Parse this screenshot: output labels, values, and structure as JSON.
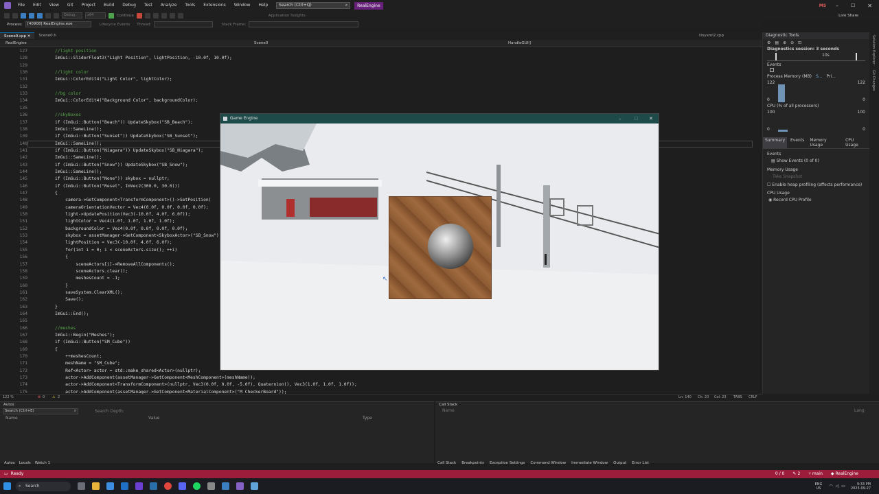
{
  "app": {
    "menu": [
      "File",
      "Edit",
      "View",
      "Git",
      "Project",
      "Build",
      "Debug",
      "Test",
      "Analyze",
      "Tools",
      "Extensions",
      "Window",
      "Help"
    ],
    "search_placeholder": "Search (Ctrl+Q)",
    "solution_name": "RealEngine",
    "user_initials": "MS",
    "live_share": "Live Share",
    "app_insights": "Application Insights",
    "continue_label": "Continue",
    "toolbar_config": "Debug",
    "toolbar_platform": "x64"
  },
  "process": {
    "label": "Process:",
    "value": "[40908] RealEngine.exe",
    "lifecycle": "Lifecycle Events",
    "thread": "Thread:",
    "stack_frame": "Stack Frame:"
  },
  "tabs": [
    {
      "label": "Scene0.cpp"
    },
    {
      "label": "Scene0.h"
    },
    {
      "label": "tinyxml2.cpp"
    }
  ],
  "navbar": {
    "project": "RealEngine",
    "scope": "Scene0",
    "member": "HandleGUI()"
  },
  "editor": {
    "line_numbers": [
      "127",
      "128",
      "129",
      "130",
      "131",
      "132",
      "133",
      "134",
      "135",
      "136",
      "137",
      "138",
      "139",
      "140",
      "141",
      "142",
      "143",
      "144",
      "145",
      "146",
      "147",
      "148",
      "149",
      "150",
      "151",
      "152",
      "153",
      "154",
      "155",
      "156",
      "157",
      "158",
      "159",
      "160",
      "161",
      "162",
      "163",
      "164",
      "165",
      "166",
      "167",
      "168",
      "169",
      "170",
      "171",
      "172",
      "173",
      "174",
      "175"
    ],
    "lines": [
      "//light position",
      "ImGui::SliderFloat3(\"Light Position\", lightPosition, -10.0f, 10.0f);",
      "",
      "//light color",
      "ImGui::ColorEdit4(\"Light Color\", lightColor);",
      "",
      "//bg color",
      "ImGui::ColorEdit4(\"Background Color\", backgroundColor);",
      "",
      "//skyBoxes",
      "if (ImGui::Button(\"Beach\")) UpdateSkybox(\"SB_Beach\");",
      "ImGui::SameLine();",
      "if (ImGui::Button(\"Sunset\")) UpdateSkybox(\"SB_Sunset\");",
      "ImGui::SameLine();",
      "if (ImGui::Button(\"Niagara\")) UpdateSkybox(\"SB_Niagara\");",
      "ImGui::SameLine();",
      "if (ImGui::Button(\"Snow\")) UpdateSkybox(\"SB_Snow\");",
      "ImGui::SameLine();",
      "if (ImGui::Button(\"None\")) skybox = nullptr;",
      "if (ImGui::Button(\"Reset\", ImVec2(300.0, 30.0)))",
      "{",
      "    camera->GetComponent<TransformComponent>()->SetPosition(",
      "    cameraOrientationVector = Vec4(0.0f, 0.0f, 0.0f, 0.0f);",
      "    light->UpdatePosition(Vec3(-10.0f, 4.0f, 6.0f));",
      "    lightColor = Vec4(1.0f, 1.0f, 1.0f, 1.0f);",
      "    backgroundColor = Vec4(0.0f, 0.0f, 0.0f, 0.0f);",
      "    skybox = assetManager->GetComponent<SkyboxActor>(\"SB_Snow\");",
      "    lightPosition = Vec3(-10.0f, 4.0f, 6.0f);",
      "    for(int i = 0; i < sceneActors.size(); ++i)",
      "    {",
      "        sceneActors[i]->RemoveAllComponents();",
      "        sceneActors.clear();",
      "        meshesCount = -1;",
      "    }",
      "    saveSystem.ClearXML();",
      "    Save();",
      "}",
      "ImGui::End();",
      "",
      "//meshes",
      "ImGui::Begin(\"Meshes\");",
      "if (ImGui::Button(\"SM_Cube\"))",
      "{",
      "    ++meshesCount;",
      "    meshName = \"SM_Cube\";",
      "    Ref<Actor> actor = std::make_shared<Actor>(nullptr);",
      "    actor->AddComponent(assetManager->GetComponent<MeshComponent>(meshName));",
      "    actor->AddComponent<TransformComponent>(nullptr, Vec3(0.0f, 0.0f, -5.0f), Quaternion(), Vec3(1.0f, 1.0f, 1.0f));",
      "    actor->AddComponent(assetManager->GetComponent<MaterialComponent>(\"M_CheckerBoard\"));"
    ]
  },
  "editor_status": {
    "zoom": "122 %",
    "errors": "0",
    "warnings": "2",
    "ln": "Ln: 140",
    "ch": "Ch: 20",
    "col": "Col: 23",
    "tabs": "TABS",
    "eol": "CRLF"
  },
  "diagnostics": {
    "title": "Diagnostic Tools",
    "session": "Diagnostics session: 3 seconds",
    "time_mark": "10s",
    "events_label": "Events",
    "process_memory": "Process Memory (MB)",
    "snapshot_legend": "S...",
    "private_legend": "Pri...",
    "mem_max_left": "122",
    "mem_max_right": "122",
    "mem_min_left": "0",
    "mem_min_right": "0",
    "cpu_title": "CPU (% of all processors)",
    "cpu_max_left": "100",
    "cpu_max_right": "100",
    "cpu_min_left": "0",
    "cpu_min_right": "0",
    "tabs": [
      "Summary",
      "Events",
      "Memory Usage",
      "CPU Usage"
    ],
    "events_section": "Events",
    "show_events": "Show Events (0 of 0)",
    "memory_section": "Memory Usage",
    "take_snapshot": "Take Snapshot",
    "enable_heap": "Enable heap profiling (affects performance)",
    "cpu_section": "CPU Usage",
    "record_cpu": "Record CPU Profile"
  },
  "right_strip": [
    "Solution Explorer",
    "Git Changes"
  ],
  "game_window": {
    "title": "Game Engine"
  },
  "autos": {
    "title": "Autos",
    "search_placeholder": "Search (Ctrl+E)",
    "search_depth": "Search Depth:",
    "col_name": "Name",
    "col_value": "Value",
    "col_type": "Type",
    "tabs": [
      "Autos",
      "Locals",
      "Watch 1"
    ]
  },
  "callstack": {
    "title": "Call Stack",
    "col_name": "Name",
    "col_lang": "Lang",
    "tabs": [
      "Call Stack",
      "Breakpoints",
      "Exception Settings",
      "Command Window",
      "Immediate Window",
      "Output",
      "Error List"
    ]
  },
  "statusbar": {
    "state": "Ready",
    "changes": "0 / 0",
    "pencil": "2",
    "branch": "main",
    "repo": "RealEngine"
  },
  "taskbar": {
    "search": "Search",
    "lang": "ENG",
    "region": "US",
    "time": "9:33 PM",
    "date": "2023-09-27"
  },
  "colors": {
    "statusbar": "#9c1c3c",
    "game_title": "#1e4a4a",
    "accent": "#68217a"
  }
}
